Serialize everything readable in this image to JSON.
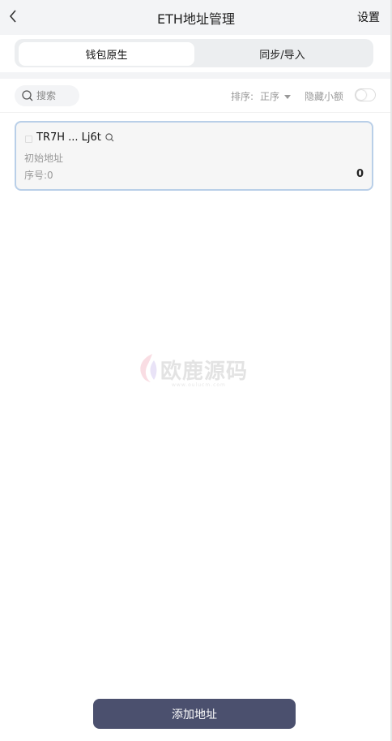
{
  "header": {
    "title": "ETH地址管理",
    "settings_label": "设置"
  },
  "tabs": [
    {
      "label": "钱包原生",
      "active": true
    },
    {
      "label": "同步/导入",
      "active": false
    }
  ],
  "toolbar": {
    "search_placeholder": "搜索",
    "sort_label": "排序:",
    "sort_value": "正序",
    "hide_small_label": "隐藏小额",
    "hide_small_on": false
  },
  "addresses": [
    {
      "address": "TR7H ... Lj6t",
      "label": "初始地址",
      "sequence": "序号:0",
      "balance": "0"
    }
  ],
  "watermark": {
    "text": "欧鹿源码",
    "sub": "www.oulucm.com"
  },
  "footer": {
    "add_button_label": "添加地址"
  },
  "colors": {
    "accent": "#4b506e",
    "card_border": "#b9cfe8",
    "header_bg": "#f3f4f6"
  }
}
